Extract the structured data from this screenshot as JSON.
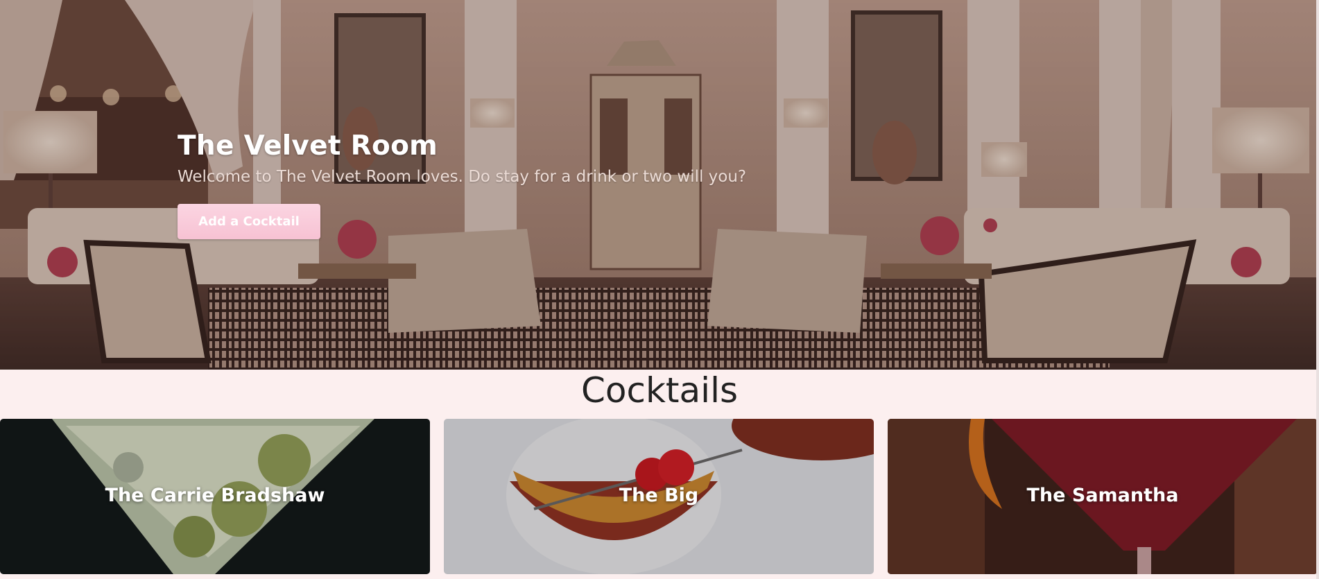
{
  "hero": {
    "title": "The Velvet Room",
    "subtitle": "Welcome to The Velvet Room loves. Do stay for a drink or two will you?",
    "button_label": "Add a Cocktail",
    "button_color": "#f7c2d3"
  },
  "cocktails": {
    "heading": "Cocktails",
    "items": [
      {
        "name": "The Carrie Bradshaw"
      },
      {
        "name": "The Big"
      },
      {
        "name": "The Samantha"
      }
    ]
  },
  "colors": {
    "page_background": "#fcefef",
    "heading_text": "#222222"
  }
}
